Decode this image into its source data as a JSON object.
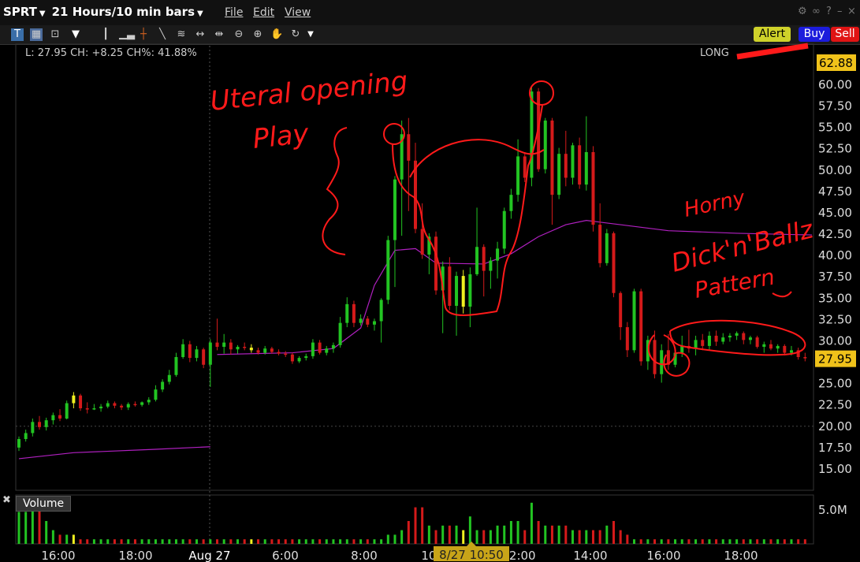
{
  "header": {
    "symbol": "SPRT",
    "period": "21 Hours/10 min bars",
    "menus": [
      "File",
      "Edit",
      "View"
    ]
  },
  "toolbar": {
    "icons": [
      "text-tool-icon",
      "image-tool-icon",
      "zoom-area-icon",
      "arrow-down-icon",
      "bar-style-icon",
      "volume-bars-icon",
      "crosshair-icon",
      "line-tool-icon",
      "fan-tool-icon",
      "expand-horizontal-icon",
      "compress-horizontal-icon",
      "zoom-out-icon",
      "zoom-in-icon",
      "hand-pan-icon",
      "refresh-icon",
      "dropdown-icon"
    ],
    "alert": "Alert",
    "buy": "Buy",
    "sell": "Sell"
  },
  "info": {
    "quote": "L: 27.95 CH: +8.25 CH%: 41.88%",
    "position": "LONG"
  },
  "volume_panel": {
    "title": "Volume",
    "scale_label": "5.0M"
  },
  "colors": {
    "up": "#22c422",
    "down": "#d41a1a",
    "neutral": "#f0f020",
    "ma": "#b020c0",
    "ink": "#ff1a1a",
    "tag_bg": "#f0c21a"
  },
  "annotations": [
    "Uteral opening",
    "Play",
    "Horny",
    "Dick'n'Ballz",
    "Pattern"
  ],
  "chart_data": {
    "type": "candlestick",
    "title": "SPRT",
    "y_ticks": [
      15.0,
      17.5,
      20.0,
      22.5,
      25.0,
      27.5,
      30.0,
      32.5,
      35.0,
      37.5,
      40.0,
      42.5,
      45.0,
      47.5,
      50.0,
      52.5,
      55.0,
      57.5,
      60.0
    ],
    "y_tick_labels": [
      "15.00",
      "17.50",
      "20.00",
      "22.50",
      "25.00",
      "27.50",
      "30.00",
      "32.50",
      "35.00",
      "37.50",
      "40.00",
      "42.50",
      "45.00",
      "47.50",
      "50.00",
      "52.50",
      "55.00",
      "57.50",
      "60.00"
    ],
    "ylim": [
      12.5,
      62.9
    ],
    "x_labels": [
      "16:00",
      "18:00",
      "Aug 27",
      "6:00",
      "8:00",
      "10:00",
      "12:00",
      "14:00",
      "16:00",
      "18:00"
    ],
    "x_label_highlight": "8/27 10:50",
    "last_price": "27.95",
    "high_price": "62.88",
    "bars": [
      [
        17.5,
        18.8,
        17.1,
        18.5
      ],
      [
        18.5,
        19.6,
        18.2,
        19.2
      ],
      [
        19.2,
        20.9,
        18.8,
        20.5
      ],
      [
        20.5,
        21.2,
        19.6,
        19.9
      ],
      [
        19.9,
        21.0,
        19.5,
        20.7
      ],
      [
        20.7,
        21.6,
        20.2,
        21.3
      ],
      [
        21.3,
        22.0,
        20.6,
        20.9
      ],
      [
        20.9,
        23.0,
        20.8,
        22.7
      ],
      [
        22.7,
        24.0,
        22.1,
        23.6
      ],
      [
        23.6,
        23.8,
        21.8,
        22.1
      ],
      [
        22.1,
        22.8,
        21.5,
        22.0
      ],
      [
        22.0,
        22.6,
        21.9,
        22.1
      ],
      [
        22.1,
        22.6,
        21.7,
        22.3
      ],
      [
        22.3,
        23.0,
        22.1,
        22.7
      ],
      [
        22.7,
        22.9,
        22.1,
        22.4
      ],
      [
        22.4,
        22.6,
        21.9,
        22.2
      ],
      [
        22.2,
        22.8,
        21.9,
        22.6
      ],
      [
        22.6,
        22.9,
        22.3,
        22.5
      ],
      [
        22.5,
        22.9,
        22.3,
        22.8
      ],
      [
        22.8,
        23.4,
        22.5,
        23.1
      ],
      [
        23.1,
        24.8,
        22.9,
        24.3
      ],
      [
        24.3,
        25.5,
        24.0,
        25.2
      ],
      [
        25.2,
        26.6,
        24.9,
        26.0
      ],
      [
        26.0,
        28.6,
        25.8,
        28.1
      ],
      [
        28.1,
        30.2,
        27.9,
        29.6
      ],
      [
        29.6,
        30.0,
        27.5,
        28.0
      ],
      [
        28.0,
        29.4,
        27.6,
        29.0
      ],
      [
        29.0,
        29.2,
        26.8,
        27.2
      ],
      [
        27.2,
        30.2,
        24.6,
        29.8
      ],
      [
        29.8,
        32.6,
        28.9,
        29.3
      ],
      [
        29.3,
        30.8,
        28.5,
        29.8
      ],
      [
        29.8,
        30.2,
        28.4,
        29.0
      ],
      [
        29.0,
        29.5,
        28.5,
        29.3
      ],
      [
        29.3,
        29.8,
        28.9,
        29.2
      ],
      [
        29.2,
        29.6,
        28.6,
        28.9
      ],
      [
        28.9,
        29.2,
        28.4,
        28.6
      ],
      [
        28.6,
        29.4,
        28.4,
        29.1
      ],
      [
        29.1,
        29.3,
        28.5,
        28.7
      ],
      [
        28.7,
        29.0,
        28.3,
        28.5
      ],
      [
        28.5,
        28.8,
        28.1,
        28.4
      ],
      [
        28.4,
        28.6,
        27.3,
        27.6
      ],
      [
        27.6,
        28.2,
        27.4,
        28.0
      ],
      [
        28.0,
        28.5,
        27.7,
        28.2
      ],
      [
        28.2,
        30.2,
        27.9,
        29.8
      ],
      [
        29.8,
        30.1,
        28.4,
        28.6
      ],
      [
        28.6,
        29.4,
        28.3,
        29.1
      ],
      [
        29.1,
        29.8,
        28.6,
        29.5
      ],
      [
        29.5,
        32.8,
        29.2,
        32.1
      ],
      [
        32.1,
        35.1,
        31.6,
        34.3
      ],
      [
        34.3,
        34.7,
        31.6,
        32.1
      ],
      [
        32.1,
        33.1,
        31.8,
        32.6
      ],
      [
        32.6,
        32.9,
        31.6,
        31.9
      ],
      [
        31.9,
        32.6,
        31.2,
        32.3
      ],
      [
        32.3,
        35.0,
        29.8,
        34.8
      ],
      [
        34.8,
        42.3,
        34.3,
        41.8
      ],
      [
        41.8,
        49.3,
        36.3,
        48.9
      ],
      [
        48.9,
        55.8,
        42.3,
        54.2
      ],
      [
        54.2,
        56.1,
        45.2,
        51.1
      ],
      [
        51.1,
        53.2,
        42.6,
        43.1
      ],
      [
        43.1,
        46.1,
        39.6,
        40.1
      ],
      [
        40.1,
        42.6,
        37.8,
        42.2
      ],
      [
        42.2,
        42.8,
        35.4,
        35.9
      ],
      [
        35.9,
        39.3,
        30.9,
        38.7
      ],
      [
        38.7,
        39.8,
        33.6,
        34.1
      ],
      [
        34.1,
        38.1,
        30.6,
        37.6
      ],
      [
        37.6,
        38.3,
        33.2,
        34.0
      ],
      [
        34.0,
        38.6,
        31.6,
        37.8
      ],
      [
        37.8,
        45.6,
        37.6,
        41.0
      ],
      [
        41.0,
        41.3,
        35.2,
        38.2
      ],
      [
        38.2,
        39.8,
        36.1,
        39.4
      ],
      [
        39.4,
        41.6,
        37.3,
        40.8
      ],
      [
        40.8,
        45.6,
        40.2,
        45.2
      ],
      [
        45.2,
        47.8,
        44.3,
        47.1
      ],
      [
        47.1,
        53.6,
        46.3,
        51.6
      ],
      [
        51.6,
        52.1,
        48.6,
        49.1
      ],
      [
        49.1,
        59.8,
        48.1,
        59.2
      ],
      [
        59.2,
        59.6,
        49.8,
        50.1
      ],
      [
        50.1,
        56.1,
        49.6,
        55.8
      ],
      [
        55.8,
        56.1,
        43.6,
        47.1
      ],
      [
        47.1,
        52.6,
        46.6,
        51.9
      ],
      [
        51.9,
        54.6,
        48.1,
        49.1
      ],
      [
        49.1,
        53.2,
        48.3,
        52.9
      ],
      [
        52.9,
        53.8,
        47.8,
        48.3
      ],
      [
        48.3,
        56.3,
        47.6,
        52.1
      ],
      [
        52.1,
        52.8,
        42.8,
        43.6
      ],
      [
        43.6,
        46.1,
        38.6,
        39.1
      ],
      [
        39.1,
        43.1,
        38.8,
        42.6
      ],
      [
        42.6,
        42.8,
        35.1,
        35.6
      ],
      [
        35.6,
        35.8,
        30.1,
        31.6
      ],
      [
        31.6,
        32.2,
        28.1,
        28.9
      ],
      [
        28.9,
        36.1,
        28.6,
        35.8
      ],
      [
        35.8,
        36.1,
        27.1,
        27.6
      ],
      [
        27.6,
        30.6,
        26.6,
        30.1
      ],
      [
        30.1,
        31.2,
        25.6,
        26.1
      ],
      [
        26.1,
        29.6,
        25.1,
        28.9
      ],
      [
        28.9,
        30.8,
        26.6,
        27.2
      ],
      [
        27.2,
        29.1,
        26.9,
        28.6
      ],
      [
        28.6,
        30.6,
        28.1,
        29.4
      ],
      [
        29.4,
        31.3,
        28.6,
        29.1
      ],
      [
        29.1,
        30.6,
        28.3,
        30.1
      ],
      [
        30.1,
        30.8,
        28.9,
        29.4
      ],
      [
        29.4,
        31.1,
        28.9,
        30.6
      ],
      [
        30.6,
        31.2,
        29.4,
        29.9
      ],
      [
        29.9,
        30.9,
        29.6,
        30.4
      ],
      [
        30.4,
        30.9,
        29.9,
        30.6
      ],
      [
        30.6,
        31.1,
        30.1,
        30.9
      ],
      [
        30.9,
        31.1,
        29.6,
        30.1
      ],
      [
        30.1,
        30.6,
        29.6,
        30.4
      ],
      [
        30.4,
        30.6,
        29.1,
        29.3
      ],
      [
        29.3,
        29.9,
        28.6,
        29.6
      ],
      [
        29.6,
        30.1,
        28.9,
        29.1
      ],
      [
        29.1,
        29.6,
        28.6,
        29.4
      ],
      [
        29.4,
        29.6,
        28.3,
        28.6
      ],
      [
        28.6,
        29.4,
        28.3,
        28.9
      ],
      [
        28.9,
        29.2,
        27.8,
        28.1
      ],
      [
        28.1,
        28.6,
        27.6,
        27.95
      ]
    ],
    "neutral_bars": [
      8,
      34,
      65
    ],
    "ma": [
      [
        0,
        16.2
      ],
      [
        8,
        16.9
      ],
      [
        20,
        17.3
      ],
      [
        28,
        17.6
      ],
      [
        29,
        28.4
      ],
      [
        40,
        28.6
      ],
      [
        46,
        29.1
      ],
      [
        50,
        31.5
      ],
      [
        52,
        36.5
      ],
      [
        55,
        40.6
      ],
      [
        58,
        40.8
      ],
      [
        61,
        39.1
      ],
      [
        68,
        39.0
      ],
      [
        72,
        40.2
      ],
      [
        76,
        42.2
      ],
      [
        80,
        43.6
      ],
      [
        83,
        44.1
      ],
      [
        88,
        43.6
      ],
      [
        95,
        42.9
      ],
      [
        105,
        42.6
      ],
      [
        116,
        42.4
      ]
    ],
    "volume": [
      7,
      7,
      8,
      8,
      5,
      3,
      2,
      2,
      2,
      1,
      1,
      1,
      1,
      1,
      1,
      1,
      1,
      1,
      1,
      1,
      1,
      1,
      1,
      1,
      1,
      1,
      1,
      1,
      1,
      1,
      1,
      1,
      1,
      1,
      1,
      1,
      1,
      1,
      1,
      1,
      1,
      1,
      1,
      1,
      1,
      1,
      1,
      1,
      1,
      1,
      1,
      1,
      1,
      1,
      2,
      2,
      3,
      5,
      8,
      8,
      4,
      3,
      4,
      4,
      4,
      3,
      6,
      3,
      3,
      3,
      4,
      4,
      5,
      5,
      3,
      9,
      5,
      4,
      4,
      4,
      4,
      3,
      3,
      3,
      3,
      3,
      4,
      5,
      3,
      2,
      1,
      1,
      1,
      1,
      1,
      1,
      1,
      1,
      1,
      1,
      1,
      1,
      1,
      1,
      1,
      1,
      1,
      1,
      1,
      1,
      1,
      1,
      1,
      1,
      1,
      1
    ],
    "volume_unit": "M"
  }
}
